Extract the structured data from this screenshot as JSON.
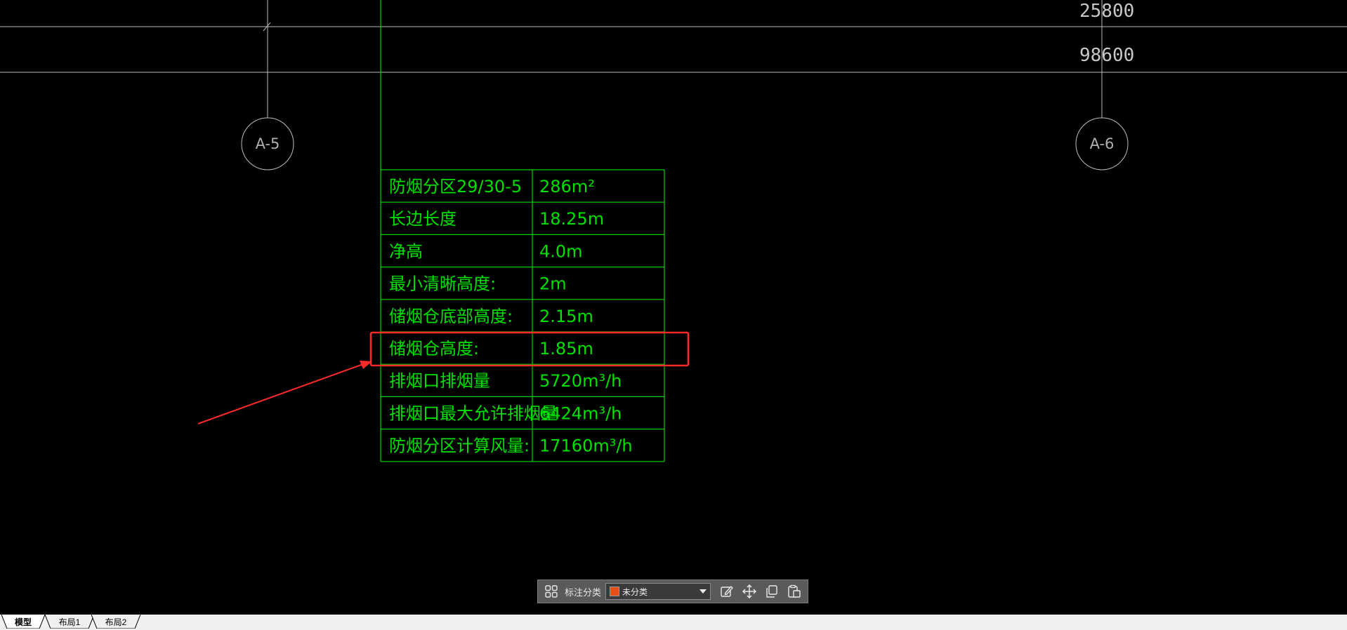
{
  "drawing": {
    "dimensions": [
      "25800",
      "98600"
    ],
    "axis_labels": [
      "A-5",
      "A-6"
    ],
    "table": {
      "rows": [
        {
          "label": "防烟分区29/30-5",
          "value": "286m²"
        },
        {
          "label": "长边长度",
          "value": "18.25m"
        },
        {
          "label": "净高",
          "value": "4.0m"
        },
        {
          "label": "最小清晰高度:",
          "value": "2m"
        },
        {
          "label": "储烟仓底部高度:",
          "value": "2.15m"
        },
        {
          "label": "储烟仓高度:",
          "value": "1.85m"
        },
        {
          "label": "排烟口排烟量",
          "value": "5720m³/h"
        },
        {
          "label": "排烟口最大允许排烟量",
          "value": "6424m³/h"
        },
        {
          "label": "防烟分区计算风量:",
          "value": "17160m³/h"
        }
      ],
      "highlighted_row": 5
    },
    "colors": {
      "background": "#000000",
      "table_lines": "#00d000",
      "table_text": "#00e000",
      "grid_lines": "#bdbdbd",
      "highlight": "#ff2a2a"
    }
  },
  "toolbar": {
    "grid_icon": "grid-icon",
    "category_label": "标注分类",
    "category_value": "未分类",
    "category_color": "#e8501a",
    "action_icons": [
      "edit-icon",
      "move-icon",
      "copy-icon",
      "paste-icon"
    ]
  },
  "tabs": [
    "模型",
    "布局1",
    "布局2"
  ],
  "active_tab": 0
}
